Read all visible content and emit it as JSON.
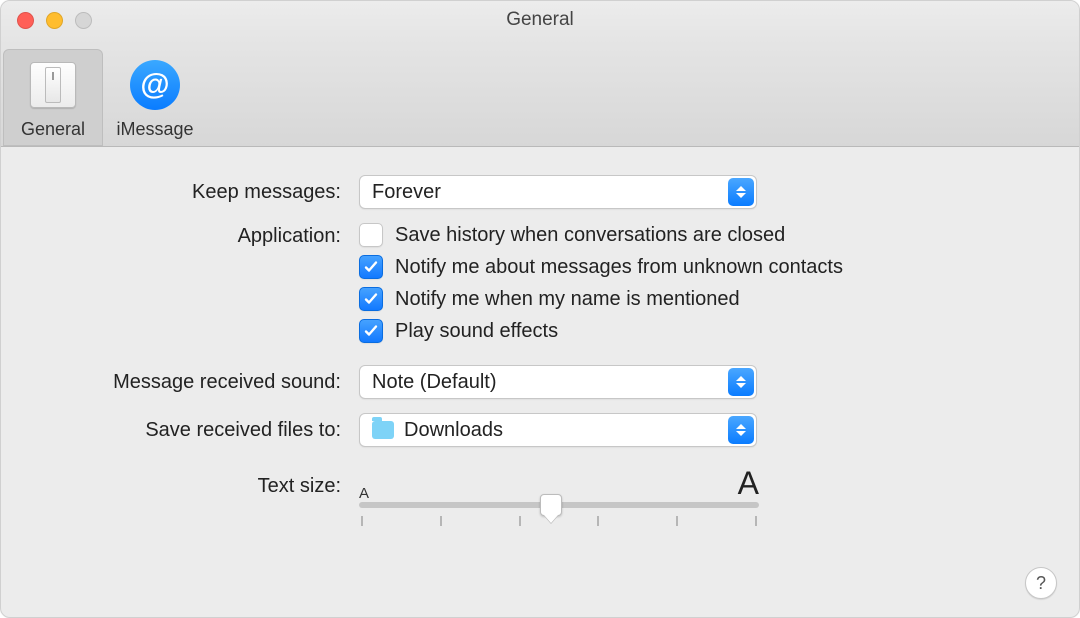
{
  "window": {
    "title": "General"
  },
  "toolbar": {
    "tabs": [
      {
        "label": "General",
        "selected": true,
        "icon": "switch-icon"
      },
      {
        "label": "iMessage",
        "selected": false,
        "icon": "at-icon"
      }
    ]
  },
  "labels": {
    "keep_messages": "Keep messages:",
    "application": "Application:",
    "message_sound": "Message received sound:",
    "save_files": "Save received files to:",
    "text_size": "Text size:"
  },
  "keep_messages": {
    "value": "Forever"
  },
  "application": {
    "save_history": {
      "checked": false,
      "label": "Save history when conversations are closed"
    },
    "notify_unknown": {
      "checked": true,
      "label": "Notify me about messages from unknown contacts"
    },
    "notify_mentioned": {
      "checked": true,
      "label": "Notify me when my name is mentioned"
    },
    "play_sounds": {
      "checked": true,
      "label": "Play sound effects"
    }
  },
  "message_sound": {
    "value": "Note (Default)"
  },
  "save_files": {
    "value": "Downloads",
    "icon": "folder-downloads-icon"
  },
  "text_size": {
    "small_glyph": "A",
    "large_glyph": "A",
    "position_percent": 48,
    "ticks": 6
  },
  "help": {
    "glyph": "?"
  }
}
